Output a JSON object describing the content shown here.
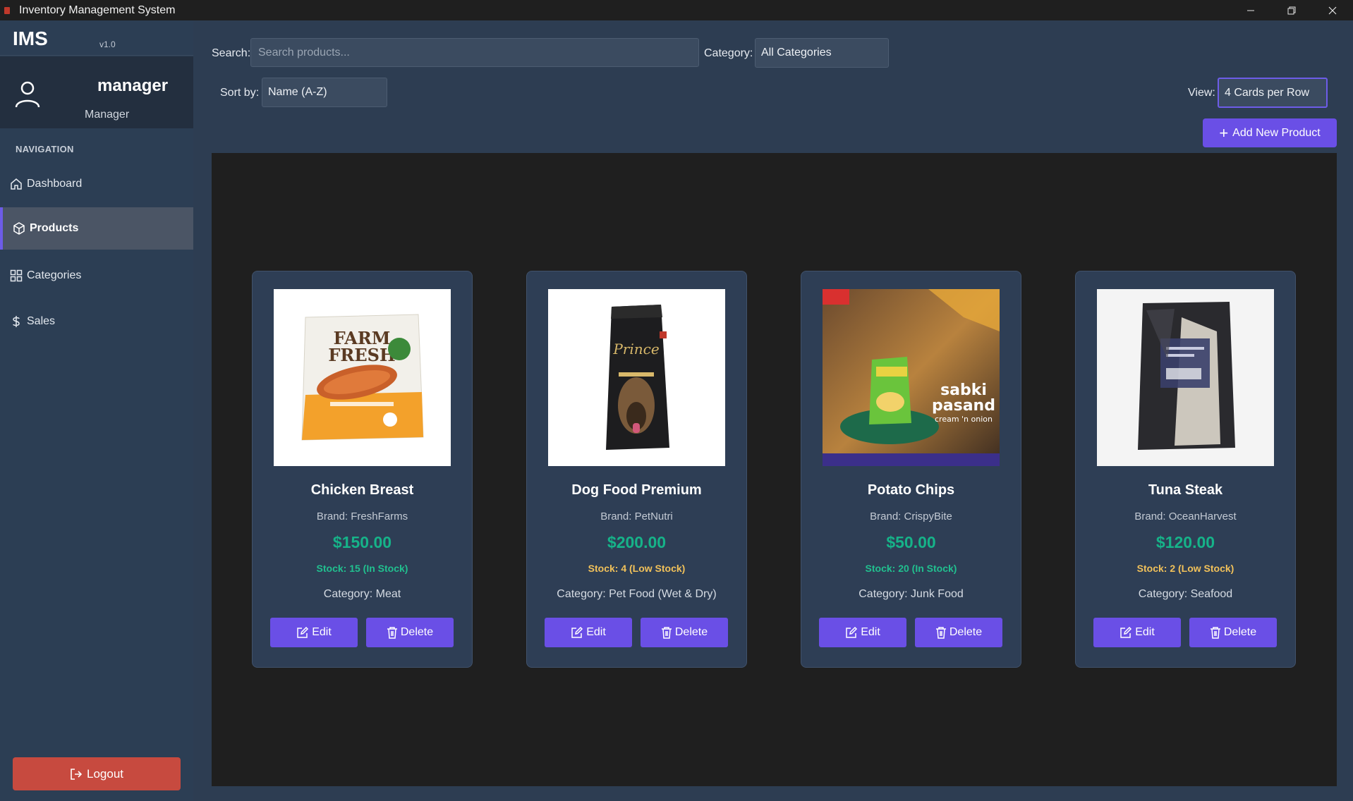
{
  "window": {
    "title": "Inventory Management System"
  },
  "sidebar": {
    "logo": "IMS",
    "version": "v1.0",
    "user": {
      "name": "manager",
      "role": "Manager"
    },
    "nav_heading": "NAVIGATION",
    "items": [
      {
        "label": "Dashboard",
        "icon": "home-icon"
      },
      {
        "label": "Products",
        "icon": "box-icon",
        "active": true
      },
      {
        "label": "Categories",
        "icon": "grid-icon"
      },
      {
        "label": "Sales",
        "icon": "dollar-icon"
      }
    ],
    "logout_label": "Logout"
  },
  "toolbar": {
    "search_label": "Search:",
    "search_placeholder": "Search products...",
    "category_label": "Category:",
    "category_value": "All Categories",
    "sort_label": "Sort by:",
    "sort_value": "Name (A-Z)",
    "view_label": "View:",
    "view_value": "4 Cards per Row",
    "add_label": "Add New Product"
  },
  "products": [
    {
      "name": "Chicken Breast",
      "brand": "Brand: FreshFarms",
      "price": "$150.00",
      "stock": "Stock: 15 (In Stock)",
      "status": "in",
      "category": "Category: Meat",
      "edit": "Edit",
      "delete": "Delete"
    },
    {
      "name": "Dog Food Premium",
      "brand": "Brand: PetNutri",
      "price": "$200.00",
      "stock": "Stock: 4 (Low Stock)",
      "status": "low",
      "category": "Category: Pet Food (Wet & Dry)",
      "edit": "Edit",
      "delete": "Delete"
    },
    {
      "name": "Potato Chips",
      "brand": "Brand: CrispyBite",
      "price": "$50.00",
      "stock": "Stock: 20 (In Stock)",
      "status": "in",
      "category": "Category: Junk Food",
      "edit": "Edit",
      "delete": "Delete"
    },
    {
      "name": "Tuna Steak",
      "brand": "Brand: OceanHarvest",
      "price": "$120.00",
      "stock": "Stock: 2 (Low Stock)",
      "status": "low",
      "category": "Category: Seafood",
      "edit": "Edit",
      "delete": "Delete"
    }
  ],
  "product_images": {
    "chips_text": [
      "sabki",
      "pasand",
      "cream 'n onion"
    ],
    "farm_text": [
      "FARM",
      "FRESH"
    ],
    "dog_text": "Prince"
  },
  "colors": {
    "accent": "#6a4fe6",
    "price": "#16b389",
    "in_stock": "#21c08f",
    "low_stock": "#f1c15a",
    "logout": "#c74a3f"
  }
}
